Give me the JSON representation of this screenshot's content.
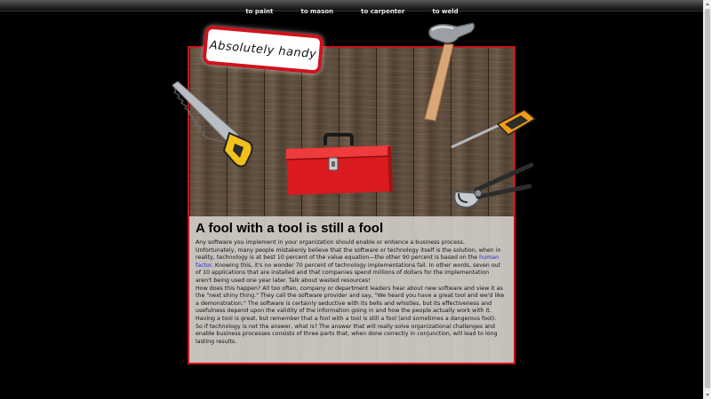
{
  "nav": {
    "items": [
      {
        "label": "to paint"
      },
      {
        "label": "to mason"
      },
      {
        "label": "to carpenter"
      },
      {
        "label": "to weld"
      }
    ]
  },
  "badge": {
    "text": "Absolutely handy"
  },
  "article": {
    "title": "A fool with a tool is still a fool",
    "p1_before_link": "Any software you implement in your organization should enable or enhance a business process. Unfortunately, many people mistakenly believe that the software or technology itself is the solution, when in reality, technology is at best 10 percent of the value equation—the other 90 percent is based on the ",
    "link": "human factor",
    "p1_after_link": ". Knowing this, it's no wonder 70 percent of technology implementations fail. In other words, seven out of 10 applications that are installed and that companies spend millions of dollars for the implementation aren't being used one year later. Talk about wasted resources!",
    "p2": "How does this happen? All too often, company or department leaders hear about new software and view it as the \"next shiny thing.\" They call the software provider and say, \"We heard you have a great tool and we'd like a demonstration.\" The software is certainly seductive with its bells and whistles, but its effectiveness and usefulness depend upon the validity of the information going in and how the people actually work with it. Having a tool is great, but remember that a fool with a tool is still a fool (and sometimes a dangerous fool).",
    "p3": "So if technology is not the answer, what is? The answer that will really solve organizational challenges and enable business processes consists of three parts that, when done correctly in conjunction, will lead to long lasting results."
  },
  "colors": {
    "frame_border": "#c8151b",
    "toolbox": "#d91a1f",
    "link": "#1a2fd6"
  },
  "icons": [
    "hand-saw-icon",
    "hammer-icon",
    "screwdriver-icon",
    "toolbox-icon",
    "pliers-icon"
  ]
}
